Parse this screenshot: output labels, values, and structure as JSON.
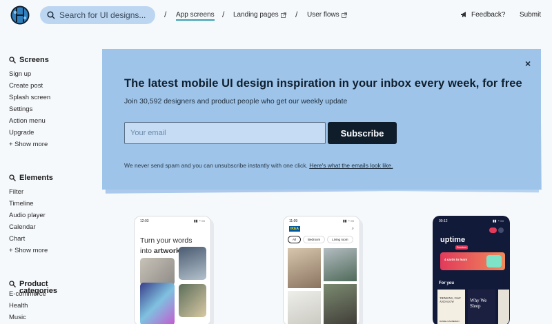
{
  "header": {
    "search_placeholder": "Search for UI designs...",
    "nav": [
      {
        "label": "App screens",
        "active": true
      },
      {
        "label": "Landing pages",
        "external": true
      },
      {
        "label": "User flows",
        "external": true
      }
    ],
    "feedback_label": "Feedback?",
    "submit_label": "Submit"
  },
  "sidebar": {
    "screens": {
      "title": "Screens",
      "items": [
        "Sign up",
        "Create post",
        "Splash screen",
        "Settings",
        "Action menu",
        "Upgrade",
        "+ Show more"
      ]
    },
    "elements": {
      "title": "Elements",
      "items": [
        "Filter",
        "Timeline",
        "Audio player",
        "Calendar",
        "Chart",
        "+ Show more"
      ]
    },
    "product": {
      "title": "Product",
      "title2": "categories",
      "items": [
        "E-commerce",
        "Health",
        "Music"
      ]
    }
  },
  "banner": {
    "title": "The latest mobile UI design inspiration in your inbox every week, for free",
    "subtitle": "Join 30,592 designers and product people who get our weekly update",
    "email_placeholder": "Your email",
    "subscribe_label": "Subscribe",
    "note": "We never send spam and you can unsubscribe instantly with one click.",
    "note_link": "Here's what the emails look like.",
    "close_label": "×"
  },
  "cards": [
    {
      "time": "12:03",
      "text1": "Turn your words",
      "text2": "into ",
      "text2_bold": "artwork"
    },
    {
      "time": "11:09",
      "brand": "IKEA",
      "chips": [
        "All",
        "Bedroom",
        "Living room"
      ]
    },
    {
      "time": "00:12",
      "brand": "uptime",
      "badge": "Premium",
      "promo": "4 cards to learn",
      "section": "For you",
      "books": [
        "THINKING, FAST AND SLOW",
        "Why We Sleep"
      ],
      "book_author": "DANIEL KAHNEMAN"
    }
  ],
  "colors": {
    "accent": "#3a9fb0",
    "banner": "#9ec4e9",
    "button": "#0f1d2b"
  }
}
